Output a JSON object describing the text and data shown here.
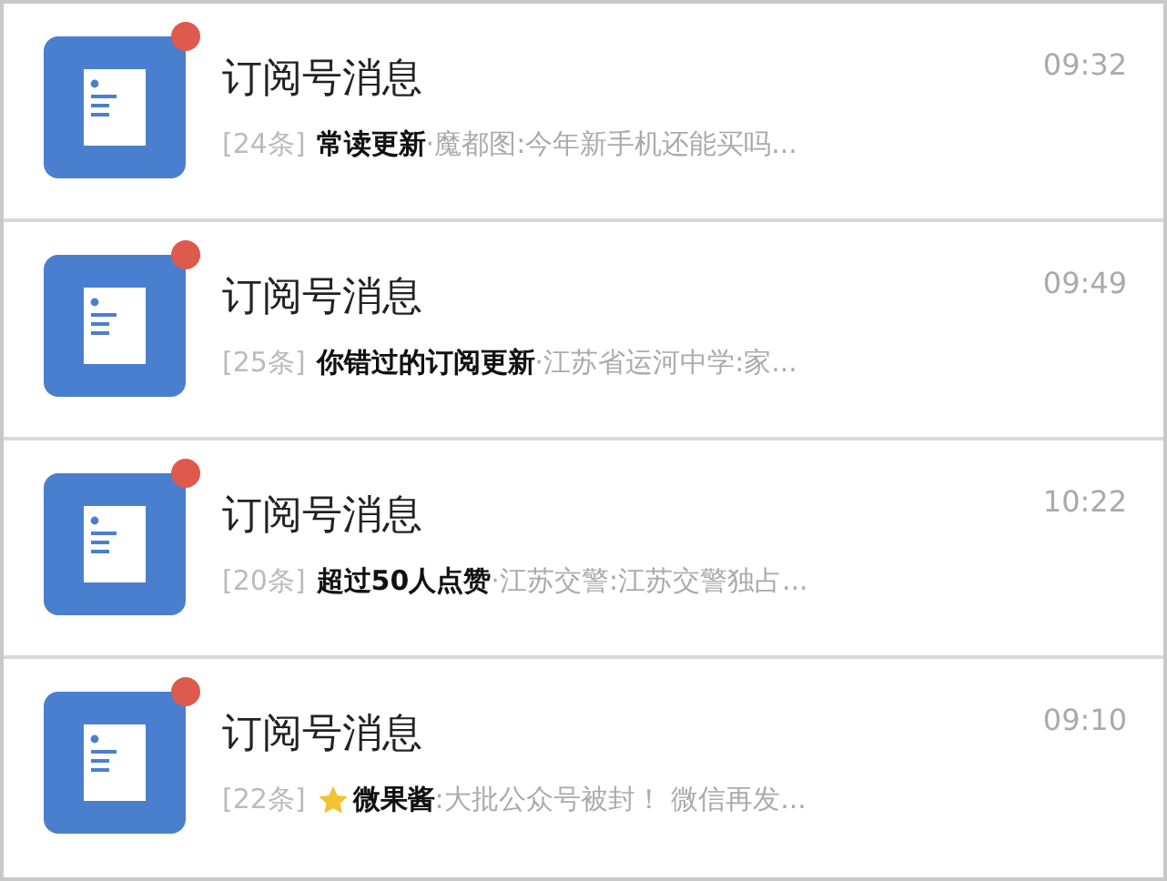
{
  "messages": [
    {
      "title": "订阅号消息",
      "time": "09:32",
      "unread": true,
      "count": "[24条]",
      "starred": false,
      "preview": "**常读更新**·魔都图:今年新手机还能买吗..."
    },
    {
      "title": "订阅号消息",
      "time": "09:49",
      "unread": true,
      "count": "[25条]",
      "starred": false,
      "preview": "**你错过的订阅更新**·江苏省运河中学:家..."
    },
    {
      "title": "订阅号消息",
      "time": "10:22",
      "unread": true,
      "count": "[20条]",
      "starred": false,
      "preview": "**超过50人点赞**·江苏交警:江苏交警独占..."
    },
    {
      "title": "订阅号消息",
      "time": "09:10",
      "unread": true,
      "count": "[22条]",
      "starred": true,
      "preview": "**微果酱**:大批公众号被封！ 微信再发..."
    }
  ]
}
